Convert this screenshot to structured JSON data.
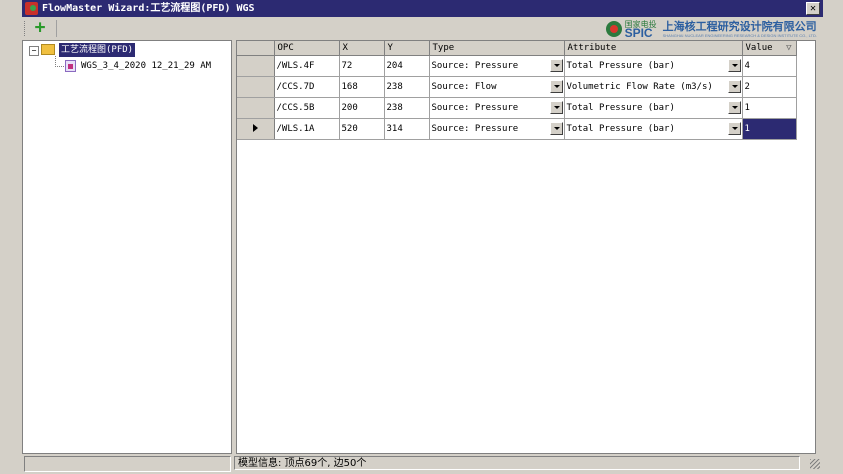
{
  "window": {
    "title": "FlowMaster Wizard:工艺流程图(PFD) WGS",
    "close_glyph": "✕"
  },
  "toolbar": {
    "add_glyph": "+",
    "logo": {
      "brand_small": "国家电投",
      "brand_large": "SPIC",
      "institute_name": "上海核工程研究设计院有限公司",
      "institute_en": "SHANGHAI NUCLEAR ENGINEERING RESEARCH & DESIGN INSTITUTE CO., LTD."
    }
  },
  "tree": {
    "root": {
      "label": "工艺流程图(PFD)",
      "expander": "−",
      "icon": "folder-open-icon"
    },
    "child": {
      "label": "WGS_3_4_2020 12_21_29 AM",
      "icon": "model-doc-icon"
    }
  },
  "grid": {
    "columns": [
      "OPC",
      "X",
      "Y",
      "Type",
      "Attribute",
      "Value"
    ],
    "sort_glyph": "▽",
    "rows": [
      {
        "opc": "/WLS.4F",
        "x": "72",
        "y": "204",
        "type": "Source: Pressure",
        "attribute": "Total Pressure (bar)",
        "value": "4",
        "current": false
      },
      {
        "opc": "/CCS.7D",
        "x": "168",
        "y": "238",
        "type": "Source: Flow",
        "attribute": "Volumetric Flow Rate (m3/s)",
        "value": "2",
        "current": false
      },
      {
        "opc": "/CCS.5B",
        "x": "200",
        "y": "238",
        "type": "Source: Pressure",
        "attribute": "Total Pressure (bar)",
        "value": "1",
        "current": false
      },
      {
        "opc": "/WLS.1A",
        "x": "520",
        "y": "314",
        "type": "Source: Pressure",
        "attribute": "Total Pressure (bar)",
        "value": "1",
        "current": true
      }
    ]
  },
  "status": {
    "left": "",
    "model_info": "模型信息: 顶点69个, 边50个"
  },
  "colors": {
    "titlebar": "#2c2a72",
    "selection": "#2c2a72",
    "chrome": "#d4d0c8"
  }
}
